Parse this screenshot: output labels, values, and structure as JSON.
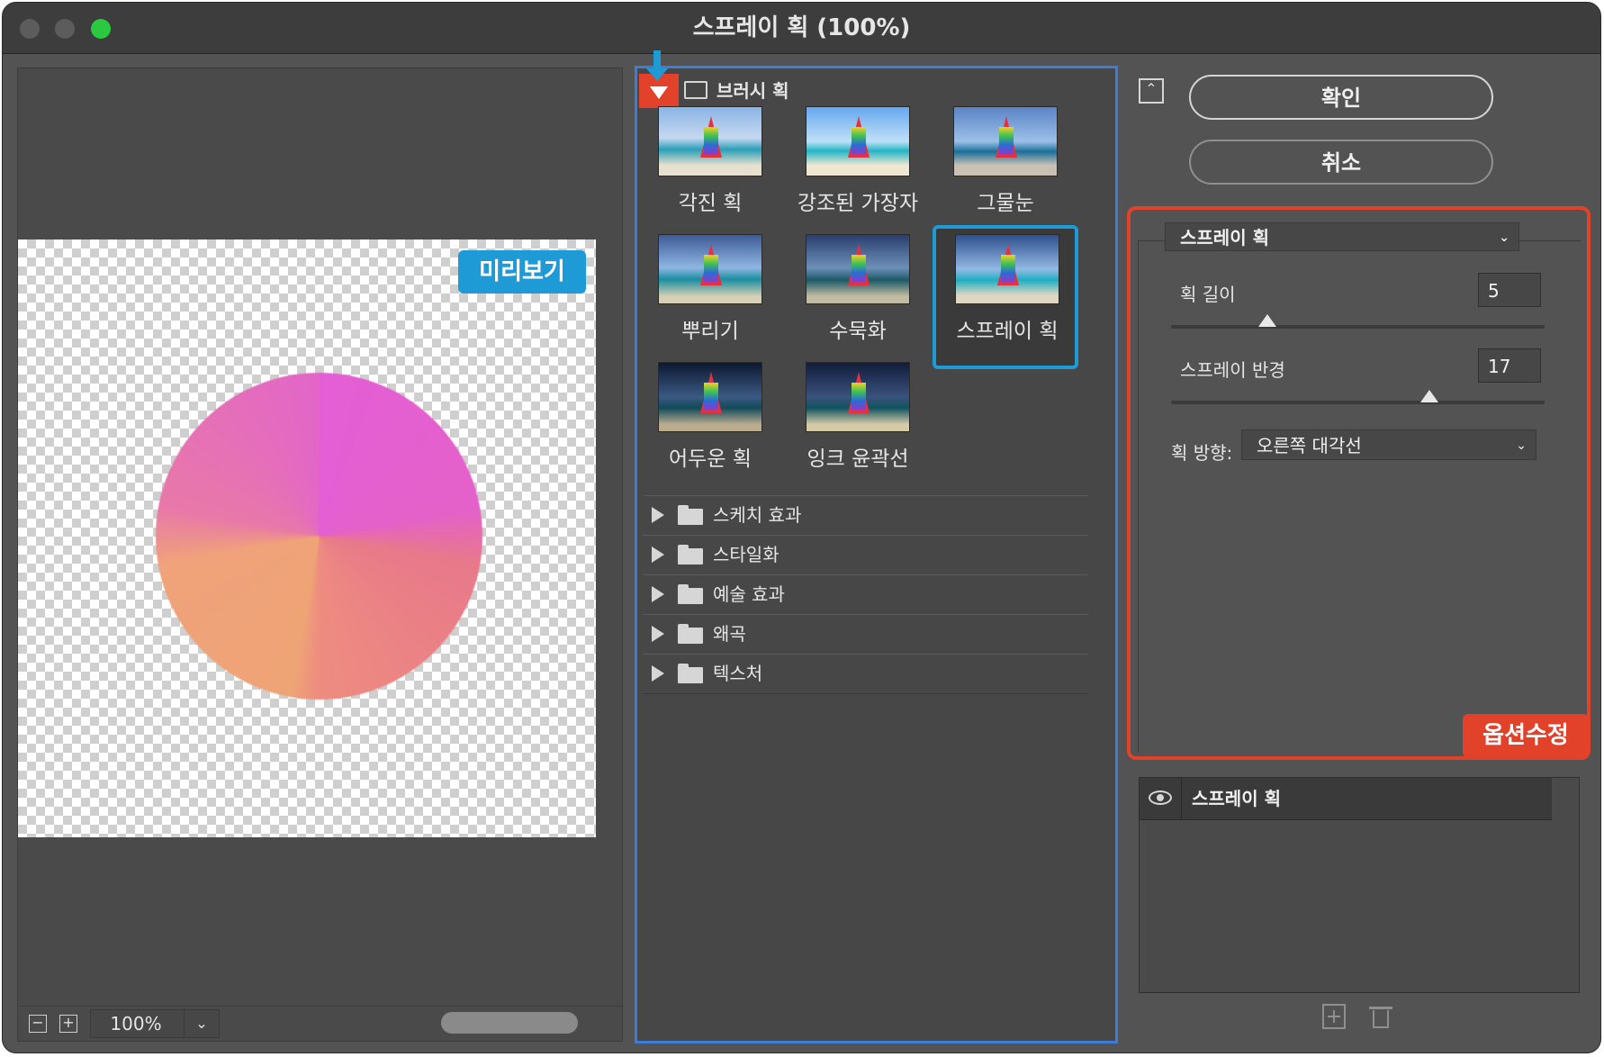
{
  "window": {
    "title": "스프레이 획 (100%)"
  },
  "preview": {
    "badge": "미리보기",
    "zoom": "100%"
  },
  "gallery": {
    "open_folder": "브러시 획",
    "thumbnails": [
      {
        "label": "각진 획"
      },
      {
        "label": "강조된 가장자"
      },
      {
        "label": "그물눈"
      },
      {
        "label": "뿌리기"
      },
      {
        "label": "수묵화"
      },
      {
        "label": "스프레이 획",
        "selected": true
      },
      {
        "label": "어두운 획"
      },
      {
        "label": "잉크 윤곽선"
      }
    ],
    "folders": [
      {
        "label": "스케치 효과"
      },
      {
        "label": "스타일화"
      },
      {
        "label": "예술 효과"
      },
      {
        "label": "왜곡"
      },
      {
        "label": "텍스처"
      }
    ]
  },
  "buttons": {
    "ok": "확인",
    "cancel": "취소"
  },
  "options": {
    "filter": "스프레이 획",
    "stroke_length_label": "획 길이",
    "stroke_length": "5",
    "spray_radius_label": "스프레이 반경",
    "spray_radius": "17",
    "direction_label": "획 방향:",
    "direction": "오른쪽 대각선",
    "badge": "옵션수정"
  },
  "layers": {
    "items": [
      {
        "name": "스프레이 획"
      }
    ]
  },
  "colors": {
    "highlight_blue": "#1e9ad6",
    "highlight_red": "#e2412a",
    "selection_border": "#3b7dd8"
  }
}
